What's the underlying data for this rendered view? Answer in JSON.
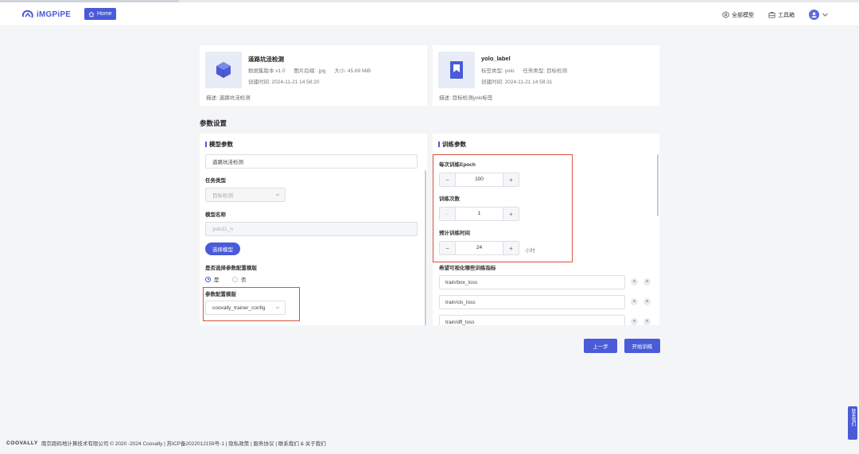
{
  "header": {
    "logo_text": "iMGPiPE",
    "home_label": "Home",
    "all_models_label": "全部模型",
    "toolbox_label": "工具箱"
  },
  "dataset_card": {
    "title": "道路坑洼检测",
    "version": "数据集版本 v1.0",
    "suffix": "图片后缀: .jpg",
    "size": "大小: 45.69 MiB",
    "created": "创建时间: 2024-11-21 14:58:20",
    "desc": "描述: 道路坑洼检测",
    "icon": "cube-icon"
  },
  "label_card": {
    "title": "yolo_label",
    "label_type": "标签类型: yolo",
    "task_type": "任务类型: 目标检测",
    "created": "创建时间: 2024-11-21 14:58:31",
    "desc": "描述: 目标检测yolo标签",
    "icon": "bookmark-icon"
  },
  "section_title": "参数设置",
  "model_params": {
    "title": "模型参数",
    "name_value": "道路坑洼检测",
    "task_type_label": "任务类型",
    "task_type_value": "目标检测",
    "model_name_label": "模型名称",
    "model_name_value": "yolo11_n",
    "select_model_btn": "选择模型",
    "use_template_label": "是否选择参数配置模版",
    "radio_yes": "是",
    "radio_no": "否",
    "template_label": "参数配置模版",
    "template_value": "coovally_trainer_config"
  },
  "train_params": {
    "title": "训练参数",
    "epoch_label": "每次训练Epoch",
    "epoch_value": "100",
    "times_label": "训练次数",
    "times_value": "1",
    "est_time_label": "预计训练时间",
    "est_time_value": "24",
    "est_time_unit": "小时",
    "metrics_label": "希望可视化哪些训练指标",
    "metrics": [
      "train/box_loss",
      "train/cls_loss",
      "train/dfl_loss"
    ]
  },
  "actions": {
    "prev": "上一步",
    "start": "开始训练"
  },
  "footer": {
    "brand": "COOVALLY",
    "text": "南京跑码地计算技术有限公司 © 2020 -2024 Coovally | 苏ICP备2022012159号-1 | 隐私政策 | 服务协议 | 联系我们 & 关于我们"
  },
  "contact_float": "联系我们",
  "colors": {
    "primary": "#4a5bd9",
    "highlight": "#d9523e"
  }
}
